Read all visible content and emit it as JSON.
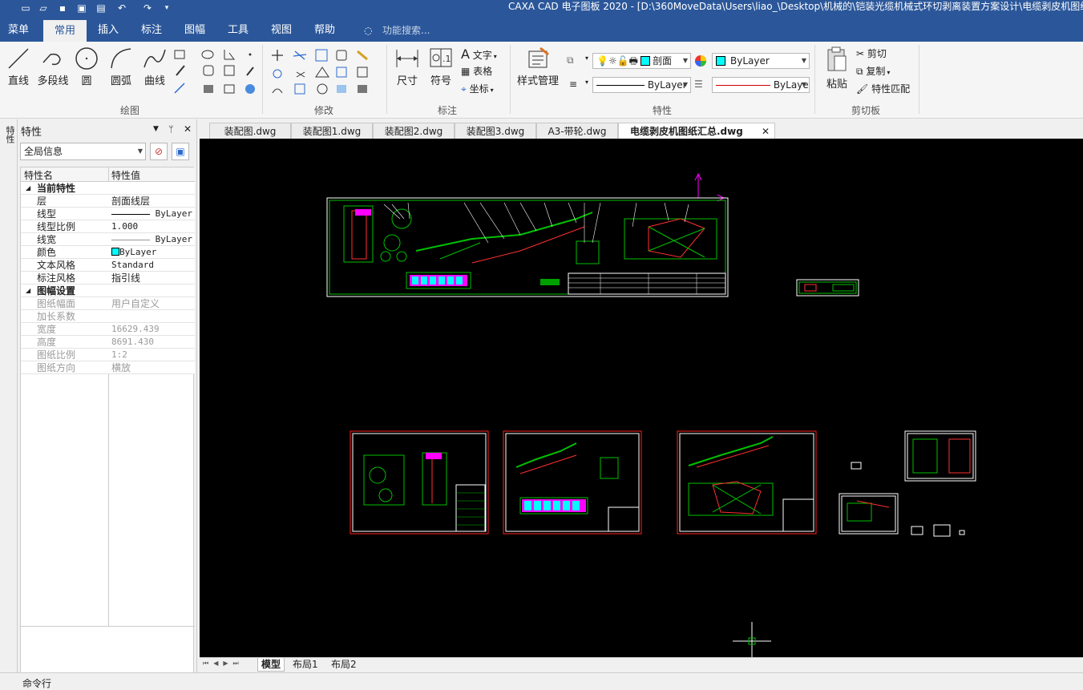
{
  "window": {
    "title": "CAXA CAD 电子图板 2020 - [D:\\360MoveData\\Users\\liao_\\Desktop\\机械的\\铠装光缆机械式环切剥离装置方案设计\\电缆剥皮机图纸"
  },
  "menu": {
    "items": [
      "菜单",
      "常用",
      "插入",
      "标注",
      "图幅",
      "工具",
      "视图",
      "帮助"
    ],
    "active": "常用",
    "search_label": "功能搜索..."
  },
  "ribbon": {
    "draw": {
      "label": "绘图",
      "tools": [
        "直线",
        "多段线",
        "圆",
        "圆弧",
        "曲线"
      ]
    },
    "modify": {
      "label": "修改"
    },
    "annotate": {
      "label": "标注",
      "tools": [
        "尺寸",
        "符号"
      ],
      "text_tools": [
        "文字",
        "表格",
        "坐标"
      ]
    },
    "properties": {
      "label": "特性",
      "style_manager": "样式管理",
      "layer_value": "剖面",
      "color_value": "ByLayer",
      "linetype_value": "ByLayer",
      "lineweight_value": "ByLaye"
    },
    "clipboard": {
      "label": "剪切板",
      "paste": "粘贴",
      "tools": [
        "剪切",
        "复制",
        "特性匹配"
      ]
    }
  },
  "props_panel": {
    "title": "特性",
    "side_tab": "特性",
    "selector": "全局信息",
    "col_name": "特性名",
    "col_value": "特性值",
    "section_current": "当前特性",
    "rows_current": [
      {
        "k": "层",
        "v": "剖面线层"
      },
      {
        "k": "线型",
        "v": "ByLayer"
      },
      {
        "k": "线型比例",
        "v": "1.000"
      },
      {
        "k": "线宽",
        "v": "ByLayer"
      },
      {
        "k": "颜色",
        "v": "ByLayer"
      },
      {
        "k": "文本风格",
        "v": "Standard"
      },
      {
        "k": "标注风格",
        "v": "指引线"
      }
    ],
    "section_sheet": "图幅设置",
    "rows_sheet": [
      {
        "k": "图纸幅面",
        "v": "用户自定义"
      },
      {
        "k": "加长系数",
        "v": ""
      },
      {
        "k": "宽度",
        "v": "16629.439"
      },
      {
        "k": "高度",
        "v": "8691.430"
      },
      {
        "k": "图纸比例",
        "v": "1:2"
      },
      {
        "k": "图纸方向",
        "v": "横放"
      }
    ]
  },
  "doc_tabs": [
    "装配图.dwg",
    "装配图1.dwg",
    "装配图2.dwg",
    "装配图3.dwg",
    "A3-带轮.dwg",
    "电缆剥皮机图纸汇总.dwg"
  ],
  "active_doc_tab": "电缆剥皮机图纸汇总.dwg",
  "layout_tabs": [
    "模型",
    "布局1",
    "布局2"
  ],
  "command_label": "命令行",
  "colors": {
    "title_blue": "#2b579a",
    "canvas": "#000000",
    "frame_white": "#ffffff",
    "frame_red": "#ff2020",
    "drawing_green": "#00c000",
    "cyan": "#00ffff",
    "magenta": "#ff00ff"
  }
}
